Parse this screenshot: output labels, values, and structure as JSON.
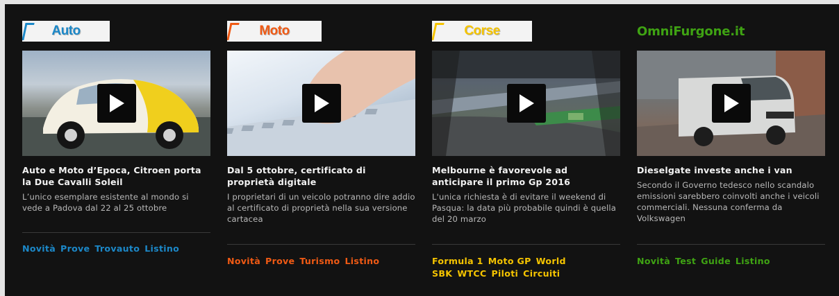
{
  "columns": [
    {
      "id": "auto",
      "logo_text": "Auto",
      "accent": "#1c88c8",
      "article": {
        "title": "Auto e Moto d’Epoca, Citroen porta la Due Cavalli Soleil",
        "description": "L’unico esemplare esistente al mondo si vede a Padova dal 22 al 25 ottobre"
      },
      "links": [
        "Novità",
        "Prove",
        "Trovauto",
        "Listino"
      ]
    },
    {
      "id": "moto",
      "logo_text": "Moto",
      "accent": "#f05a14",
      "article": {
        "title": "Dal 5 ottobre, certificato di proprietà digitale",
        "description": "I proprietari di un veicolo potranno dire addio al certificato di proprietà nella sua versione cartacea"
      },
      "links": [
        "Novità",
        "Prove",
        "Turismo",
        "Listino"
      ]
    },
    {
      "id": "corse",
      "logo_text": "Corse",
      "accent": "#f5c400",
      "article": {
        "title": "Melbourne è favorevole ad anticipare il primo Gp 2016",
        "description": "L'unica richiesta è di evitare il weekend di Pasqua: la data più probabile quindi è quella del 20 marzo"
      },
      "links": [
        "Formula 1",
        "Moto GP",
        "World SBK",
        "WTCC",
        "Piloti",
        "Circuiti"
      ]
    },
    {
      "id": "furgone",
      "logo_text": "OmniFurgone.it",
      "accent": "#3fa313",
      "article": {
        "title": "Dieselgate investe anche i van",
        "description": "Secondo il Governo tedesco nello scandalo emissioni sarebbero coinvolti anche i veicoli commerciali. Nessuna conferma da Volkswagen"
      },
      "links": [
        "Novità",
        "Test",
        "Guide",
        "Listino"
      ]
    }
  ],
  "icons": {
    "play": "play-icon"
  }
}
